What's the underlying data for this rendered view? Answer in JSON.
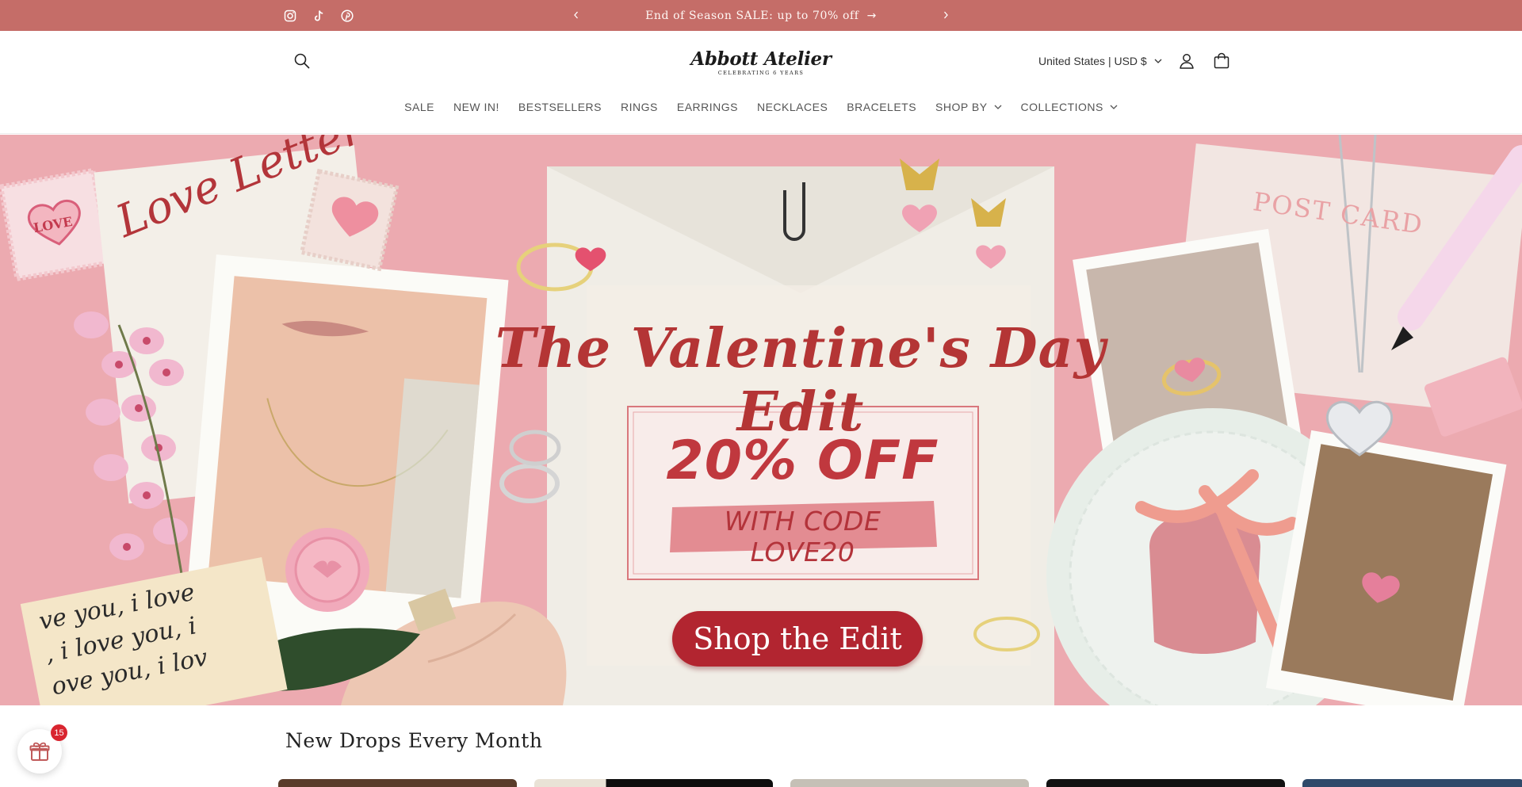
{
  "announcement": {
    "text": "End of Season SALE: up to 70% off",
    "arrow": "→",
    "prev_icon": "chevron-left-icon",
    "next_icon": "chevron-right-icon",
    "background": "#c56d68"
  },
  "social": [
    {
      "name": "instagram-icon"
    },
    {
      "name": "tiktok-icon"
    },
    {
      "name": "pinterest-icon"
    }
  ],
  "header": {
    "logo_main": "Abbott Atelier",
    "logo_sub": "CELEBRATING 6 YEARS",
    "currency": "United States | USD $",
    "icons": [
      "search-icon",
      "account-icon",
      "cart-icon"
    ]
  },
  "nav": {
    "items": [
      {
        "label": "SALE",
        "dropdown": false
      },
      {
        "label": "NEW IN!",
        "dropdown": false
      },
      {
        "label": "BESTSELLERS",
        "dropdown": false
      },
      {
        "label": "RINGS",
        "dropdown": false
      },
      {
        "label": "EARRINGS",
        "dropdown": false
      },
      {
        "label": "NECKLACES",
        "dropdown": false
      },
      {
        "label": "BRACELETS",
        "dropdown": false
      },
      {
        "label": "SHOP BY",
        "dropdown": true
      },
      {
        "label": "COLLECTIONS",
        "dropdown": true
      }
    ]
  },
  "hero": {
    "title": "The Valentine's Day Edit",
    "discount": "20% OFF",
    "code_text": "WITH CODE LOVE20",
    "cta": "Shop the Edit",
    "letter_text": "Love Letter",
    "postcard_text": "POST CARD",
    "stamp_text": "LOVE",
    "note_lines": [
      "ve you, i love",
      ", i love you, i",
      "ove you, i lov"
    ],
    "accent": "#b22530"
  },
  "section": {
    "title": "New Drops Every Month"
  },
  "rewards": {
    "icon": "gift-icon",
    "badge": "15"
  }
}
